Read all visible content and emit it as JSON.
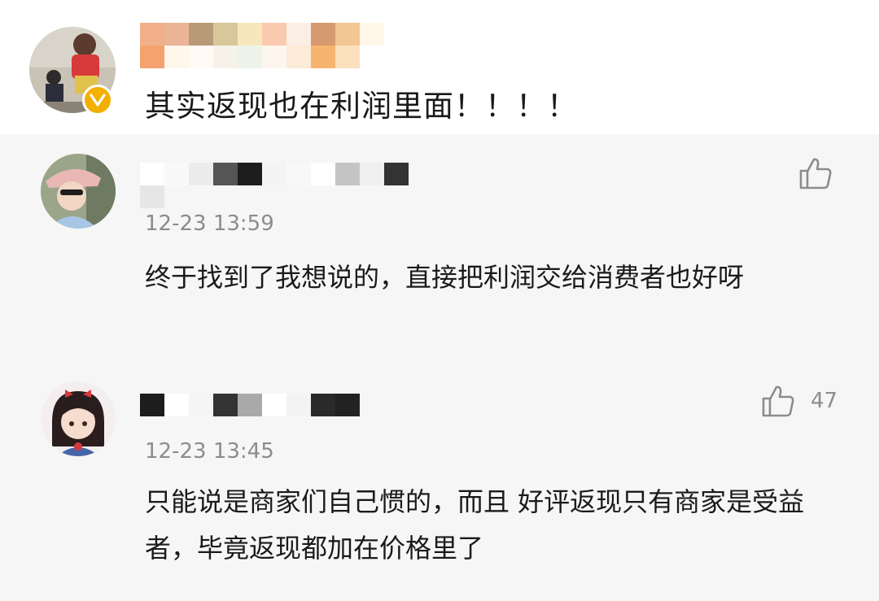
{
  "post": {
    "text": "其实返现也在利润里面！！！！",
    "avatar": "user-avatar",
    "badge": "verified-badge-icon",
    "badge_color": "#f3b000"
  },
  "replies": [
    {
      "time": "12-23 13:59",
      "text": "终于找到了我想说的，直接把利润交给消费者也好呀",
      "like_icon": "thumbs-up-icon",
      "like_count": ""
    },
    {
      "time": "12-23 13:45",
      "text": "只能说是商家们自己惯的，而且 好评返现只有商家是受益者，毕竟返现都加在价格里了",
      "like_icon": "thumbs-up-icon",
      "like_count": "47"
    }
  ],
  "colors": {
    "reply_background": "#f6f6f6",
    "secondary_text": "#8c8c8c",
    "primary_text": "#1a1a1a"
  }
}
